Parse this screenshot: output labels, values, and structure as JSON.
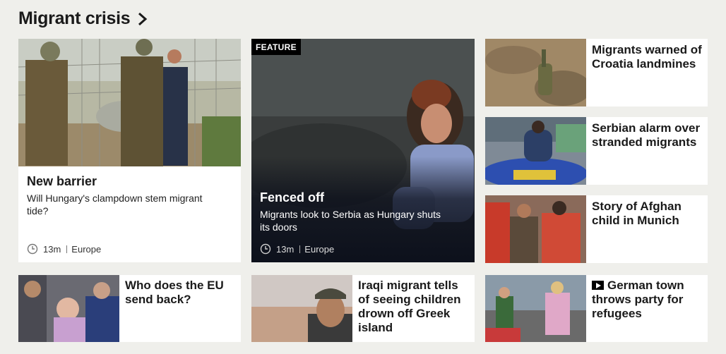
{
  "section": {
    "title": "Migrant crisis"
  },
  "lead": {
    "headline": "New barrier",
    "summary": "Will Hungary's clampdown stem migrant tide?",
    "time": "13m",
    "tag": "Europe"
  },
  "feature": {
    "badge": "FEATURE",
    "headline": "Fenced off",
    "summary": "Migrants look to Serbia as Hungary shuts its doors",
    "time": "13m",
    "tag": "Europe"
  },
  "side_stories": [
    {
      "headline": "Migrants warned of Croatia landmines"
    },
    {
      "headline": "Serbian alarm over stranded migrants"
    },
    {
      "headline": "Story of Afghan child in Munich"
    }
  ],
  "bottom_stories": [
    {
      "headline": "Who does the EU send back?"
    },
    {
      "headline": "Iraqi migrant tells of seeing children drown off Greek island"
    },
    {
      "headline": "German town throws party for refugees",
      "icon": "play-icon"
    }
  ]
}
